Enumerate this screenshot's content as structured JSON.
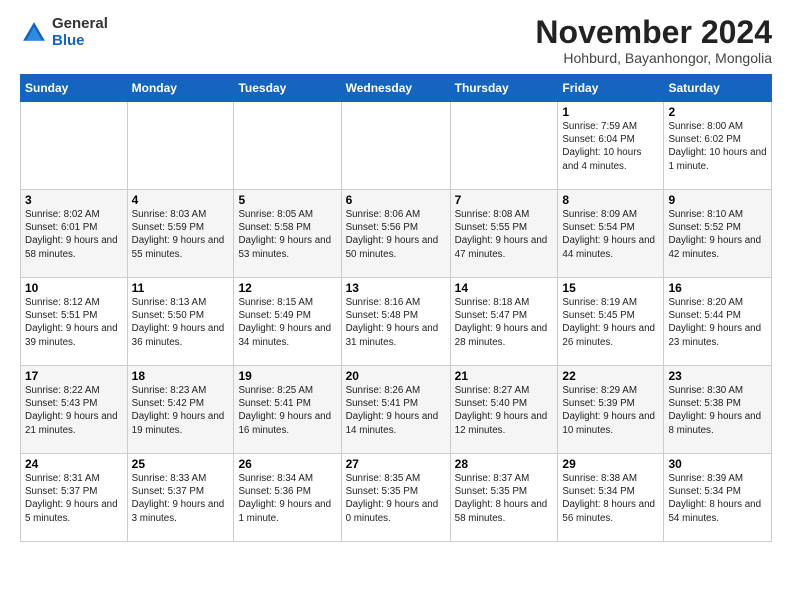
{
  "logo": {
    "general": "General",
    "blue": "Blue"
  },
  "header": {
    "month": "November 2024",
    "location": "Hohburd, Bayanhongor, Mongolia"
  },
  "weekdays": [
    "Sunday",
    "Monday",
    "Tuesday",
    "Wednesday",
    "Thursday",
    "Friday",
    "Saturday"
  ],
  "weeks": [
    [
      {
        "day": "",
        "info": ""
      },
      {
        "day": "",
        "info": ""
      },
      {
        "day": "",
        "info": ""
      },
      {
        "day": "",
        "info": ""
      },
      {
        "day": "",
        "info": ""
      },
      {
        "day": "1",
        "info": "Sunrise: 7:59 AM\nSunset: 6:04 PM\nDaylight: 10 hours and 4 minutes."
      },
      {
        "day": "2",
        "info": "Sunrise: 8:00 AM\nSunset: 6:02 PM\nDaylight: 10 hours and 1 minute."
      }
    ],
    [
      {
        "day": "3",
        "info": "Sunrise: 8:02 AM\nSunset: 6:01 PM\nDaylight: 9 hours and 58 minutes."
      },
      {
        "day": "4",
        "info": "Sunrise: 8:03 AM\nSunset: 5:59 PM\nDaylight: 9 hours and 55 minutes."
      },
      {
        "day": "5",
        "info": "Sunrise: 8:05 AM\nSunset: 5:58 PM\nDaylight: 9 hours and 53 minutes."
      },
      {
        "day": "6",
        "info": "Sunrise: 8:06 AM\nSunset: 5:56 PM\nDaylight: 9 hours and 50 minutes."
      },
      {
        "day": "7",
        "info": "Sunrise: 8:08 AM\nSunset: 5:55 PM\nDaylight: 9 hours and 47 minutes."
      },
      {
        "day": "8",
        "info": "Sunrise: 8:09 AM\nSunset: 5:54 PM\nDaylight: 9 hours and 44 minutes."
      },
      {
        "day": "9",
        "info": "Sunrise: 8:10 AM\nSunset: 5:52 PM\nDaylight: 9 hours and 42 minutes."
      }
    ],
    [
      {
        "day": "10",
        "info": "Sunrise: 8:12 AM\nSunset: 5:51 PM\nDaylight: 9 hours and 39 minutes."
      },
      {
        "day": "11",
        "info": "Sunrise: 8:13 AM\nSunset: 5:50 PM\nDaylight: 9 hours and 36 minutes."
      },
      {
        "day": "12",
        "info": "Sunrise: 8:15 AM\nSunset: 5:49 PM\nDaylight: 9 hours and 34 minutes."
      },
      {
        "day": "13",
        "info": "Sunrise: 8:16 AM\nSunset: 5:48 PM\nDaylight: 9 hours and 31 minutes."
      },
      {
        "day": "14",
        "info": "Sunrise: 8:18 AM\nSunset: 5:47 PM\nDaylight: 9 hours and 28 minutes."
      },
      {
        "day": "15",
        "info": "Sunrise: 8:19 AM\nSunset: 5:45 PM\nDaylight: 9 hours and 26 minutes."
      },
      {
        "day": "16",
        "info": "Sunrise: 8:20 AM\nSunset: 5:44 PM\nDaylight: 9 hours and 23 minutes."
      }
    ],
    [
      {
        "day": "17",
        "info": "Sunrise: 8:22 AM\nSunset: 5:43 PM\nDaylight: 9 hours and 21 minutes."
      },
      {
        "day": "18",
        "info": "Sunrise: 8:23 AM\nSunset: 5:42 PM\nDaylight: 9 hours and 19 minutes."
      },
      {
        "day": "19",
        "info": "Sunrise: 8:25 AM\nSunset: 5:41 PM\nDaylight: 9 hours and 16 minutes."
      },
      {
        "day": "20",
        "info": "Sunrise: 8:26 AM\nSunset: 5:41 PM\nDaylight: 9 hours and 14 minutes."
      },
      {
        "day": "21",
        "info": "Sunrise: 8:27 AM\nSunset: 5:40 PM\nDaylight: 9 hours and 12 minutes."
      },
      {
        "day": "22",
        "info": "Sunrise: 8:29 AM\nSunset: 5:39 PM\nDaylight: 9 hours and 10 minutes."
      },
      {
        "day": "23",
        "info": "Sunrise: 8:30 AM\nSunset: 5:38 PM\nDaylight: 9 hours and 8 minutes."
      }
    ],
    [
      {
        "day": "24",
        "info": "Sunrise: 8:31 AM\nSunset: 5:37 PM\nDaylight: 9 hours and 5 minutes."
      },
      {
        "day": "25",
        "info": "Sunrise: 8:33 AM\nSunset: 5:37 PM\nDaylight: 9 hours and 3 minutes."
      },
      {
        "day": "26",
        "info": "Sunrise: 8:34 AM\nSunset: 5:36 PM\nDaylight: 9 hours and 1 minute."
      },
      {
        "day": "27",
        "info": "Sunrise: 8:35 AM\nSunset: 5:35 PM\nDaylight: 9 hours and 0 minutes."
      },
      {
        "day": "28",
        "info": "Sunrise: 8:37 AM\nSunset: 5:35 PM\nDaylight: 8 hours and 58 minutes."
      },
      {
        "day": "29",
        "info": "Sunrise: 8:38 AM\nSunset: 5:34 PM\nDaylight: 8 hours and 56 minutes."
      },
      {
        "day": "30",
        "info": "Sunrise: 8:39 AM\nSunset: 5:34 PM\nDaylight: 8 hours and 54 minutes."
      }
    ]
  ]
}
